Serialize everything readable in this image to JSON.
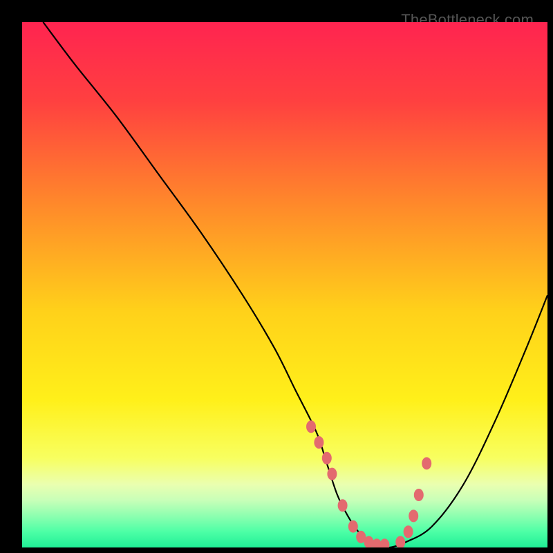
{
  "watermark": "TheBottleneck.com",
  "chart_data": {
    "type": "line",
    "title": "",
    "xlabel": "",
    "ylabel": "",
    "xlim": [
      0,
      100
    ],
    "ylim": [
      0,
      100
    ],
    "background_gradient": {
      "stops": [
        {
          "offset": 0.0,
          "color": "#ff2450"
        },
        {
          "offset": 0.15,
          "color": "#ff4040"
        },
        {
          "offset": 0.35,
          "color": "#ff8a2a"
        },
        {
          "offset": 0.55,
          "color": "#ffd11a"
        },
        {
          "offset": 0.72,
          "color": "#fff01a"
        },
        {
          "offset": 0.83,
          "color": "#f8ff60"
        },
        {
          "offset": 0.88,
          "color": "#eaffb0"
        },
        {
          "offset": 0.91,
          "color": "#c8ffb8"
        },
        {
          "offset": 0.94,
          "color": "#8dffb0"
        },
        {
          "offset": 0.97,
          "color": "#4dffa6"
        },
        {
          "offset": 1.0,
          "color": "#20ef96"
        }
      ]
    },
    "series": [
      {
        "name": "curve",
        "type": "line",
        "color": "#000000",
        "x": [
          4,
          10,
          18,
          26,
          34,
          42,
          48,
          52,
          56,
          58,
          60,
          62,
          64,
          66,
          68,
          70,
          73,
          78,
          84,
          90,
          96,
          100
        ],
        "y": [
          100,
          92,
          82,
          71,
          60,
          48,
          38,
          30,
          22,
          16,
          10,
          6,
          3,
          1,
          0,
          0,
          1,
          4,
          12,
          24,
          38,
          48
        ]
      },
      {
        "name": "marker-cluster",
        "type": "scatter",
        "color": "#e36a6f",
        "x": [
          55,
          56.5,
          58,
          59,
          61,
          63,
          64.5,
          66,
          67.5,
          69,
          72,
          73.5,
          74.5,
          75.5,
          77
        ],
        "y": [
          23,
          20,
          17,
          14,
          8,
          4,
          2,
          1,
          0.5,
          0.5,
          1,
          3,
          6,
          10,
          16
        ]
      }
    ]
  }
}
